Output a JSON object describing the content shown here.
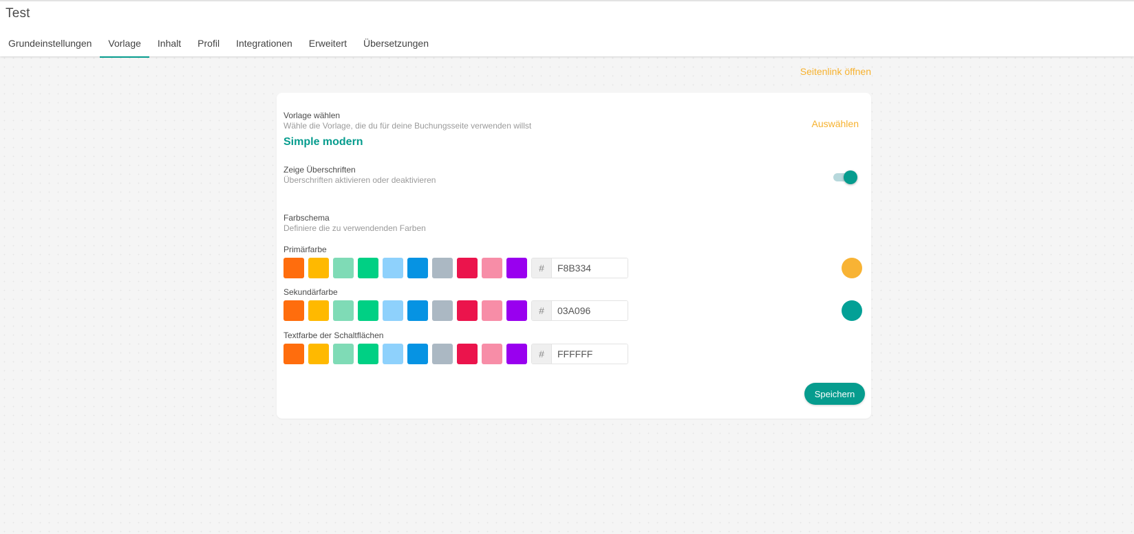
{
  "header": {
    "title": "Test",
    "tabs": [
      {
        "label": "Grundeinstellungen",
        "active": false
      },
      {
        "label": "Vorlage",
        "active": true
      },
      {
        "label": "Inhalt",
        "active": false
      },
      {
        "label": "Profil",
        "active": false
      },
      {
        "label": "Integrationen",
        "active": false
      },
      {
        "label": "Erweitert",
        "active": false
      },
      {
        "label": "Übersetzungen",
        "active": false
      }
    ]
  },
  "open_link_label": "Seitenlink öffnen",
  "template": {
    "title": "Vorlage wählen",
    "description": "Wähle die Vorlage, die du für deine Buchungsseite verwenden willst",
    "selected": "Simple modern",
    "select_label": "Auswählen"
  },
  "headings": {
    "title": "Zeige Überschriften",
    "description": "Überschriften aktivieren oder deaktivieren",
    "enabled": true
  },
  "color_scheme": {
    "title": "Farbschema",
    "description": "Definiere die zu verwendenden Farben",
    "hash_symbol": "#",
    "swatches": [
      "#ff6d0d",
      "#ffb900",
      "#7fdbb6",
      "#00d084",
      "#8ed1fc",
      "#0693e3",
      "#abb8c3",
      "#eb144c",
      "#f78da7",
      "#9900ef"
    ],
    "primary": {
      "label": "Primärfarbe",
      "value": "F8B334",
      "preview_color": "#f8b334"
    },
    "secondary": {
      "label": "Sekundärfarbe",
      "value": "03A096",
      "preview_color": "#03a096"
    },
    "button_text": {
      "label": "Textfarbe der Schaltflächen",
      "value": "FFFFFF"
    }
  },
  "save_label": "Speichern",
  "colors": {
    "accent": "#069c8e",
    "link": "#f6b12e"
  }
}
